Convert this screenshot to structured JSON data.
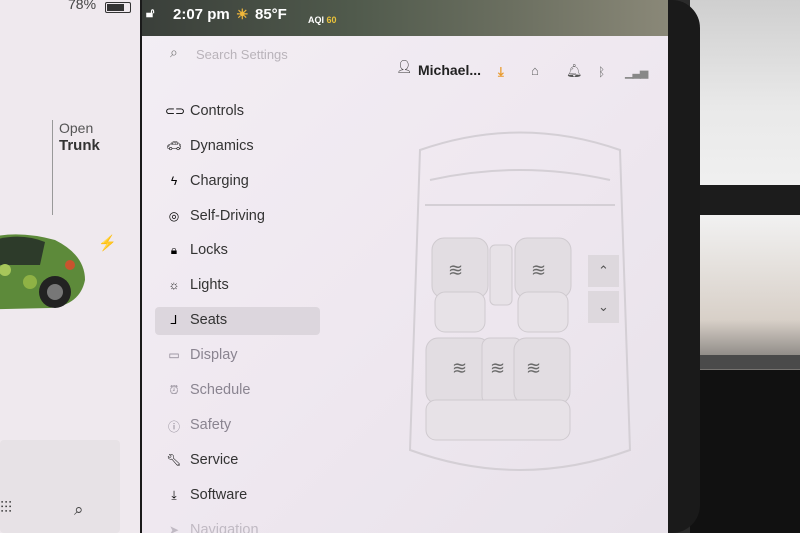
{
  "status": {
    "battery_percent": "78%",
    "time": "2:07 pm",
    "temperature": "85°F",
    "aqi_label": "AQI",
    "aqi_value": "60",
    "accent_aqi": "#e9c23b"
  },
  "left": {
    "trunk_line1": "Open",
    "trunk_line2": "Trunk"
  },
  "search": {
    "placeholder": "Search Settings"
  },
  "header": {
    "profile_name": "Michael..."
  },
  "menu": {
    "items": [
      {
        "label": "Controls",
        "icon": "toggle-icon"
      },
      {
        "label": "Dynamics",
        "icon": "car-icon"
      },
      {
        "label": "Charging",
        "icon": "bolt-icon"
      },
      {
        "label": "Self-Driving",
        "icon": "steering-wheel-icon"
      },
      {
        "label": "Locks",
        "icon": "lock-icon"
      },
      {
        "label": "Lights",
        "icon": "light-icon"
      },
      {
        "label": "Seats",
        "icon": "seat-icon",
        "selected": true
      },
      {
        "label": "Display",
        "icon": "display-icon"
      },
      {
        "label": "Schedule",
        "icon": "clock-icon"
      },
      {
        "label": "Safety",
        "icon": "info-icon"
      },
      {
        "label": "Service",
        "icon": "wrench-icon"
      },
      {
        "label": "Software",
        "icon": "download-icon"
      },
      {
        "label": "Navigation",
        "icon": "navigation-icon"
      }
    ]
  },
  "colors": {
    "download_accent": "#e99a2c",
    "selected_bg": "#dcd6dd"
  }
}
